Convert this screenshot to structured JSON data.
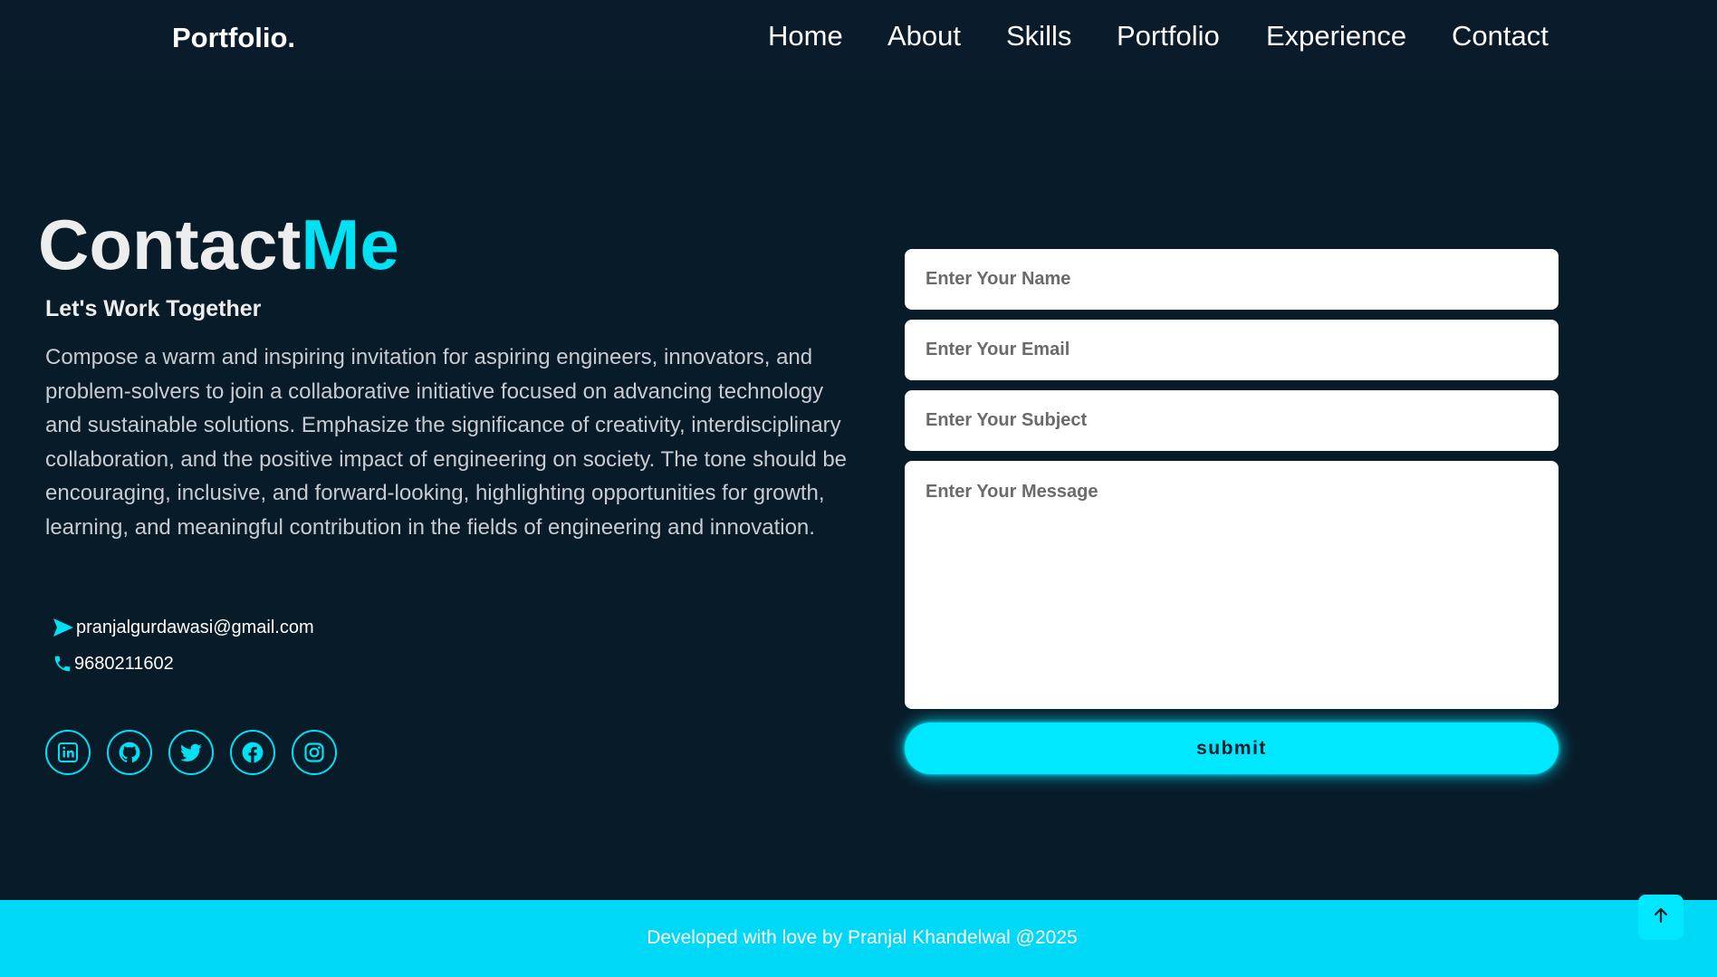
{
  "header": {
    "logo": "Portfolio.",
    "nav": [
      "Home",
      "About",
      "Skills",
      "Portfolio",
      "Experience",
      "Contact"
    ]
  },
  "contact": {
    "heading_main": "Contact",
    "heading_accent": "Me",
    "subheading": "Let's Work Together",
    "description": "Compose a warm and inspiring invitation for aspiring engineers, innovators, and problem-solvers to join a collaborative initiative focused on advancing technology and sustainable solutions. Emphasize the significance of creativity, interdisciplinary collaboration, and the positive impact of engineering on society. The tone should be encouraging, inclusive, and forward-looking, highlighting opportunities for growth, learning, and meaningful contribution in the fields of engineering and innovation.",
    "email": "pranjalgurdawasi@gmail.com",
    "phone": "9680211602",
    "socials": [
      "linkedin-icon",
      "github-icon",
      "twitter-icon",
      "facebook-icon",
      "instagram-icon"
    ]
  },
  "form": {
    "name_placeholder": "Enter Your Name",
    "email_placeholder": "Enter Your Email",
    "subject_placeholder": "Enter Your Subject",
    "message_placeholder": "Enter Your Message",
    "submit_label": "submit"
  },
  "footer": {
    "text": "Developed with love by Pranjal Khandelwal @2025"
  },
  "colors": {
    "background": "#081b29",
    "accent": "#00e1f3",
    "footer": "#00d8f7"
  }
}
